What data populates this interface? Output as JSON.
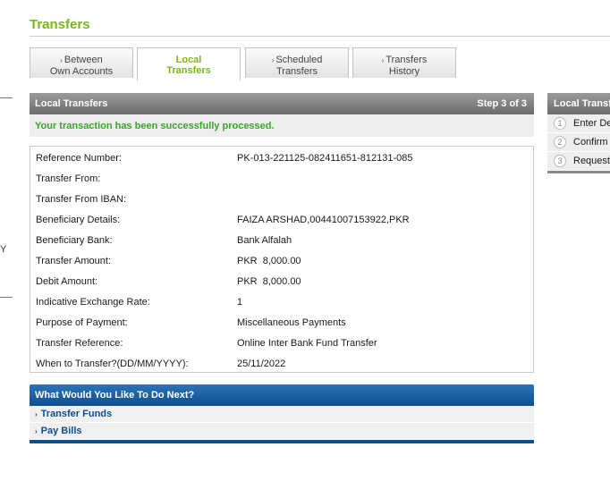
{
  "page": {
    "title": "Transfers"
  },
  "side": {
    "letter": "Y"
  },
  "tabs": [
    {
      "label": "Between\nOwn Accounts",
      "line1": "Between",
      "line2": "Own Accounts",
      "chevron": "›"
    },
    {
      "label": "Local\nTransfers",
      "line1": "Local",
      "line2": "Transfers",
      "active": true
    },
    {
      "label": "Scheduled\nTransfers",
      "line1": "Scheduled",
      "line2": "Transfers",
      "chevron": "›"
    },
    {
      "label": "Transfers\nHistory",
      "line1": "Transfers",
      "line2": "History",
      "chevron": "›"
    }
  ],
  "panel": {
    "title": "Local Transfers",
    "step": "Step 3 of 3",
    "success_message": "Your transaction has been successfully processed."
  },
  "details": [
    {
      "label": "Reference Number:",
      "value": "PK-013-221125-082411651-812131-085"
    },
    {
      "label": "Transfer From:",
      "value": ""
    },
    {
      "label": "Transfer From IBAN:",
      "value": ""
    },
    {
      "label": "Beneficiary Details:",
      "value": "FAIZA ARSHAD,00441007153922,PKR"
    },
    {
      "label": "Beneficiary Bank:",
      "value": "Bank Alfalah"
    },
    {
      "label": "Transfer Amount:",
      "value": "PKR  8,000.00"
    },
    {
      "label": "Debit Amount:",
      "value": "PKR  8,000.00"
    },
    {
      "label": "Indicative Exchange Rate:",
      "value": "1"
    },
    {
      "label": "Purpose of Payment:",
      "value": "Miscellaneous Payments"
    },
    {
      "label": "Transfer Reference:",
      "value": "Online Inter Bank Fund Transfer"
    },
    {
      "label": "When to Transfer?(DD/MM/YYYY):",
      "value": "25/11/2022"
    }
  ],
  "next": {
    "title": "What Would You Like To Do Next?",
    "links": [
      {
        "label": "Transfer Funds",
        "chevron": "›"
      },
      {
        "label": "Pay Bills",
        "chevron": "›"
      }
    ]
  },
  "steps": {
    "title": "Local Transfers",
    "items": [
      {
        "num": "1",
        "label": "Enter Details"
      },
      {
        "num": "2",
        "label": "Confirm"
      },
      {
        "num": "3",
        "label": "Request"
      }
    ]
  },
  "colors": {
    "accent_green": "#7ab51d",
    "success_green": "#3aa52a",
    "header_grey": "#7a7a7a",
    "next_blue": "#0e4f91"
  }
}
